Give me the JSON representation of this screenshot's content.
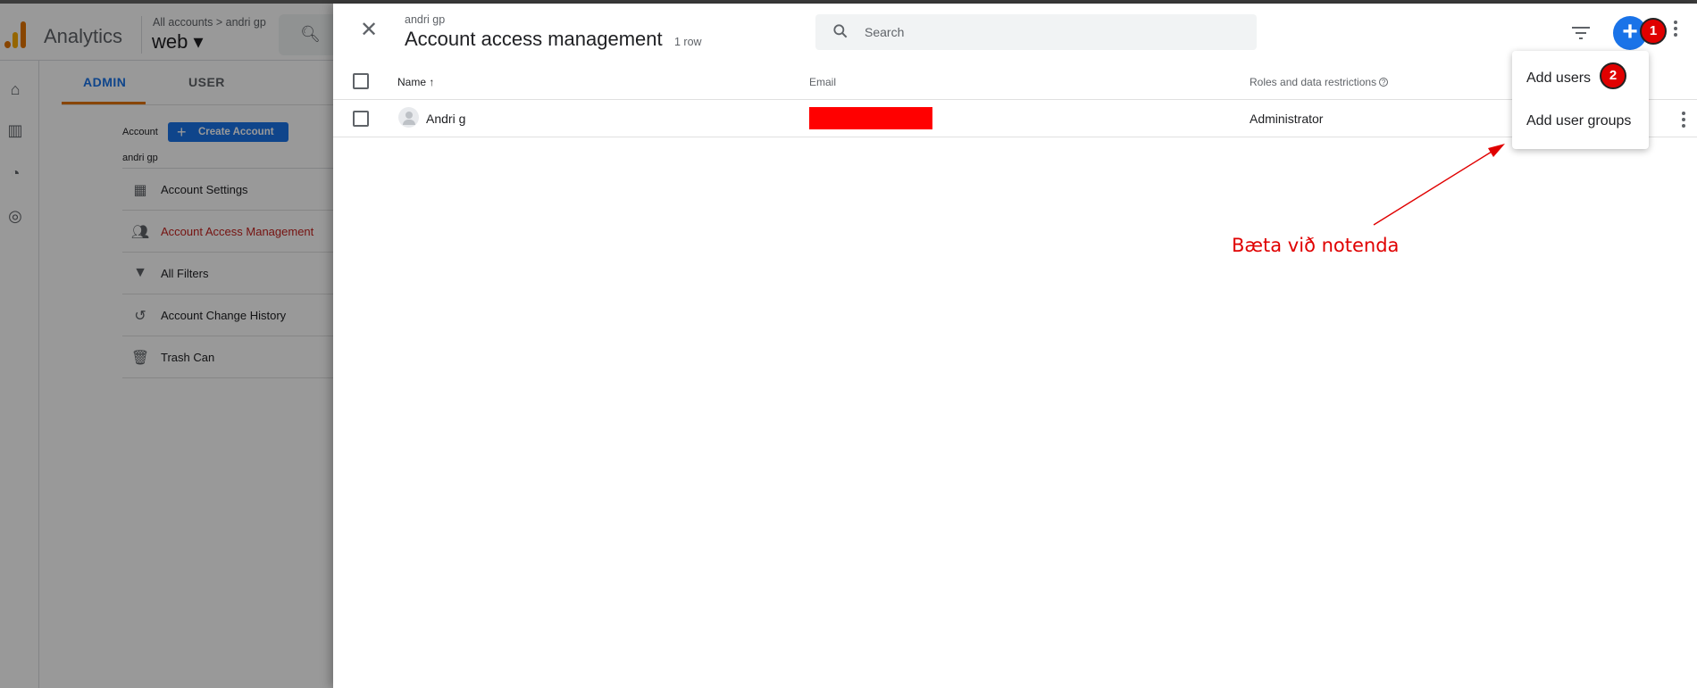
{
  "app": {
    "name": "Analytics",
    "breadcrumb": "All accounts > andri gp",
    "property": "web ▾"
  },
  "admin_tabs": [
    {
      "label": "ADMIN"
    },
    {
      "label": "USER"
    }
  ],
  "account": {
    "label": "Account",
    "create_button": "Create Account",
    "name": "andri gp"
  },
  "nav": [
    {
      "label": "Account Settings",
      "icon": "building-icon"
    },
    {
      "label": "Account Access Management",
      "icon": "people-icon"
    },
    {
      "label": "All Filters",
      "icon": "filter-icon"
    },
    {
      "label": "Account Change History",
      "icon": "history-icon"
    },
    {
      "label": "Trash Can",
      "icon": "trash-icon"
    }
  ],
  "panel": {
    "subtitle": "andri gp",
    "title": "Account access management",
    "row_count": "1 row",
    "search_placeholder": "Search",
    "columns": {
      "name": "Name",
      "email": "Email",
      "roles": "Roles and data restrictions"
    },
    "rows": [
      {
        "name": "Andri g",
        "email_redacted": true,
        "role": "Administrator"
      }
    ]
  },
  "menu": {
    "add_users": "Add users",
    "add_user_groups": "Add user groups"
  },
  "annotations": {
    "badge_1": "1",
    "badge_2": "2",
    "note": "Bæta við notenda",
    "color": "#e00000"
  },
  "colors": {
    "accent": "#1a73e8",
    "active_nav": "#c5221f",
    "redaction": "#ff0000"
  }
}
